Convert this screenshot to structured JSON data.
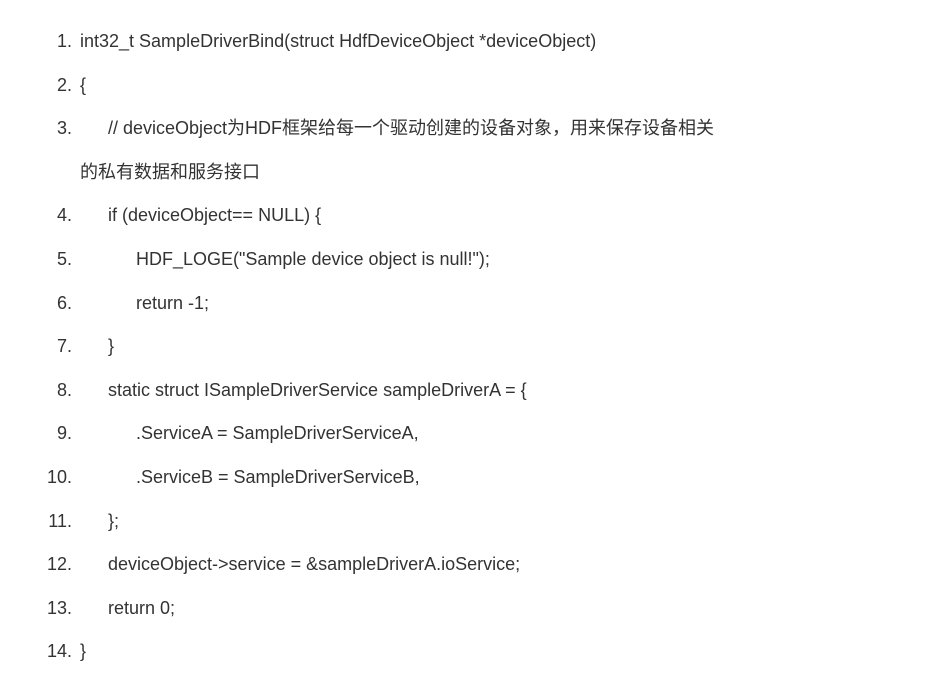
{
  "code": {
    "lines": [
      {
        "num": "1",
        "indent": 1,
        "text": "int32_t SampleDriverBind(struct HdfDeviceObject *deviceObject)"
      },
      {
        "num": "2",
        "indent": 1,
        "text": "{"
      },
      {
        "num": "3",
        "indent": 2,
        "text": "// deviceObject为HDF框架给每一个驱动创建的设备对象，用来保存设备相关",
        "wrap": "的私有数据和服务接口"
      },
      {
        "num": "4",
        "indent": 2,
        "text": "if (deviceObject== NULL) {"
      },
      {
        "num": "5",
        "indent": 3,
        "text": "HDF_LOGE(\"Sample device object is null!\");"
      },
      {
        "num": "6",
        "indent": 3,
        "text": "return -1;"
      },
      {
        "num": "7",
        "indent": 2,
        "text": "}"
      },
      {
        "num": "8",
        "indent": 2,
        "text": "static struct ISampleDriverService sampleDriverA = {"
      },
      {
        "num": "9",
        "indent": 3,
        "text": ".ServiceA = SampleDriverServiceA,"
      },
      {
        "num": "10",
        "indent": 3,
        "text": ".ServiceB = SampleDriverServiceB,"
      },
      {
        "num": "11",
        "indent": 2,
        "text": "};"
      },
      {
        "num": "12",
        "indent": 2,
        "text": "deviceObject->service = &sampleDriverA.ioService;"
      },
      {
        "num": "13",
        "indent": 2,
        "text": "return 0;"
      },
      {
        "num": "14",
        "indent": 1,
        "text": "}"
      }
    ]
  }
}
